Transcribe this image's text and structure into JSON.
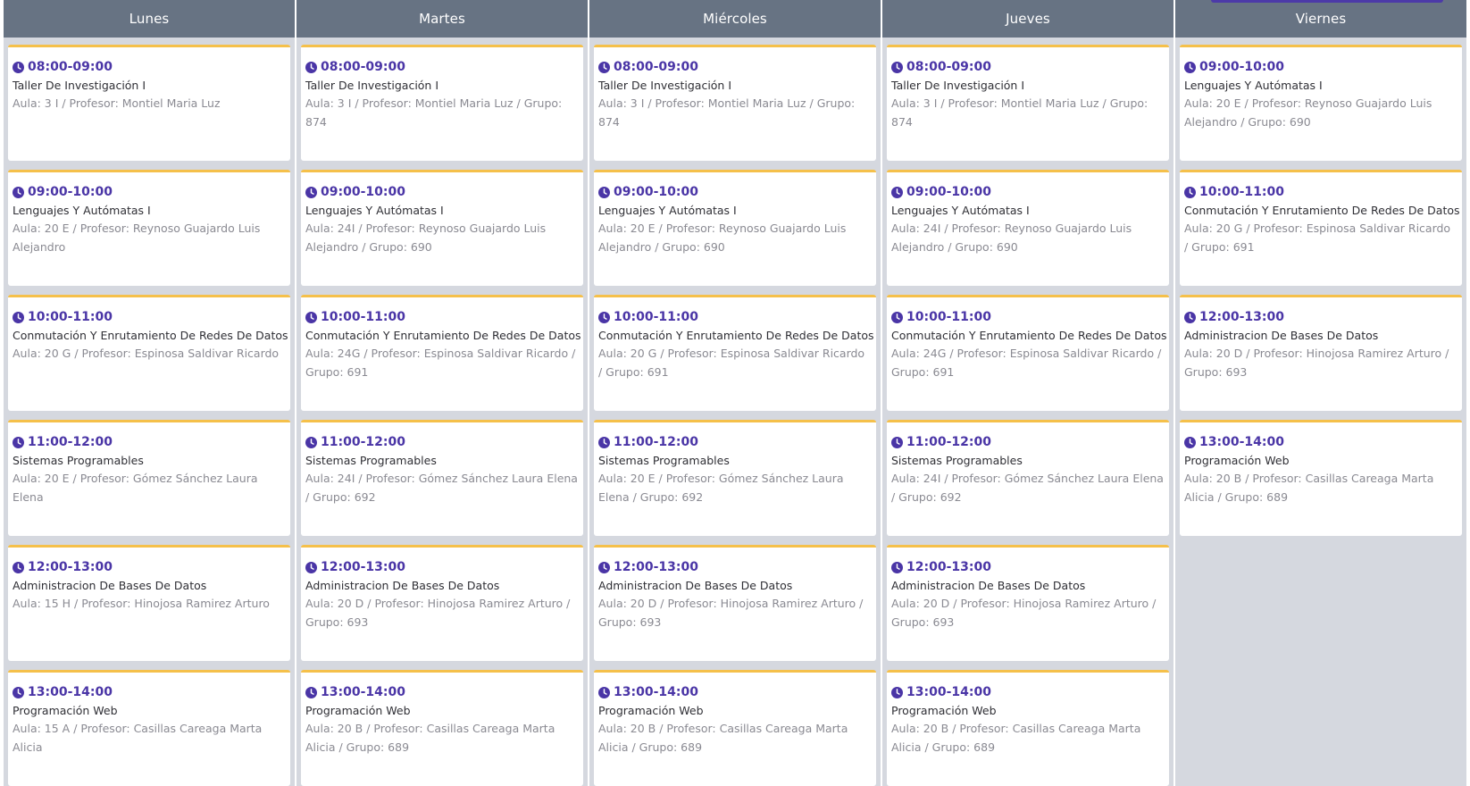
{
  "colors": {
    "header_bg": "#677383",
    "column_bg": "#d5d8df",
    "card_accent": "#f5c04a",
    "time_text": "#4a35a6",
    "detail_text": "#8a8a92"
  },
  "icons": {
    "time": "clock-icon"
  },
  "days": [
    {
      "name": "Lunes",
      "classes": [
        {
          "time": "08:00-09:00",
          "subject": "Taller De Investigación I",
          "details": "Aula: 3 I / Profesor: Montiel Maria Luz"
        },
        {
          "time": "09:00-10:00",
          "subject": "Lenguajes Y Autómatas I",
          "details": "Aula: 20 E / Profesor: Reynoso Guajardo Luis Alejandro"
        },
        {
          "time": "10:00-11:00",
          "subject": "Conmutación Y Enrutamiento De Redes De Datos",
          "details": "Aula: 20 G / Profesor: Espinosa Saldivar Ricardo"
        },
        {
          "time": "11:00-12:00",
          "subject": "Sistemas Programables",
          "details": "Aula: 20 E / Profesor: Gómez Sánchez Laura Elena"
        },
        {
          "time": "12:00-13:00",
          "subject": "Administracion De Bases De Datos",
          "details": "Aula: 15 H / Profesor: Hinojosa Ramirez Arturo"
        },
        {
          "time": "13:00-14:00",
          "subject": "Programación Web",
          "details": "Aula: 15 A / Profesor: Casillas Careaga Marta Alicia"
        }
      ]
    },
    {
      "name": "Martes",
      "classes": [
        {
          "time": "08:00-09:00",
          "subject": "Taller De Investigación I",
          "details": "Aula: 3 I / Profesor: Montiel Maria Luz / Grupo: 874"
        },
        {
          "time": "09:00-10:00",
          "subject": "Lenguajes Y Autómatas I",
          "details": "Aula: 24I / Profesor: Reynoso Guajardo Luis Alejandro / Grupo: 690"
        },
        {
          "time": "10:00-11:00",
          "subject": "Conmutación Y Enrutamiento De Redes De Datos",
          "details": "Aula: 24G / Profesor: Espinosa Saldivar Ricardo / Grupo: 691"
        },
        {
          "time": "11:00-12:00",
          "subject": "Sistemas Programables",
          "details": "Aula: 24I / Profesor: Gómez Sánchez Laura Elena / Grupo: 692"
        },
        {
          "time": "12:00-13:00",
          "subject": "Administracion De Bases De Datos",
          "details": "Aula: 20 D / Profesor: Hinojosa Ramirez Arturo / Grupo: 693"
        },
        {
          "time": "13:00-14:00",
          "subject": "Programación Web",
          "details": "Aula: 20 B / Profesor: Casillas Careaga Marta Alicia / Grupo: 689"
        }
      ]
    },
    {
      "name": "Miércoles",
      "classes": [
        {
          "time": "08:00-09:00",
          "subject": "Taller De Investigación I",
          "details": "Aula: 3 I / Profesor: Montiel Maria Luz / Grupo: 874"
        },
        {
          "time": "09:00-10:00",
          "subject": "Lenguajes Y Autómatas I",
          "details": "Aula: 20 E / Profesor: Reynoso Guajardo Luis Alejandro / Grupo: 690"
        },
        {
          "time": "10:00-11:00",
          "subject": "Conmutación Y Enrutamiento De Redes De Datos",
          "details": "Aula: 20 G / Profesor: Espinosa Saldivar Ricardo / Grupo: 691"
        },
        {
          "time": "11:00-12:00",
          "subject": "Sistemas Programables",
          "details": "Aula: 20 E / Profesor: Gómez Sánchez Laura Elena / Grupo: 692"
        },
        {
          "time": "12:00-13:00",
          "subject": "Administracion De Bases De Datos",
          "details": "Aula: 20 D / Profesor: Hinojosa Ramirez Arturo / Grupo: 693"
        },
        {
          "time": "13:00-14:00",
          "subject": "Programación Web",
          "details": "Aula: 20 B / Profesor: Casillas Careaga Marta Alicia / Grupo: 689"
        }
      ]
    },
    {
      "name": "Jueves",
      "classes": [
        {
          "time": "08:00-09:00",
          "subject": "Taller De Investigación I",
          "details": "Aula: 3 I / Profesor: Montiel Maria Luz / Grupo: 874"
        },
        {
          "time": "09:00-10:00",
          "subject": "Lenguajes Y Autómatas I",
          "details": "Aula: 24I / Profesor: Reynoso Guajardo Luis Alejandro / Grupo: 690"
        },
        {
          "time": "10:00-11:00",
          "subject": "Conmutación Y Enrutamiento De Redes De Datos",
          "details": "Aula: 24G / Profesor: Espinosa Saldivar Ricardo / Grupo: 691"
        },
        {
          "time": "11:00-12:00",
          "subject": "Sistemas Programables",
          "details": "Aula: 24I / Profesor: Gómez Sánchez Laura Elena / Grupo: 692"
        },
        {
          "time": "12:00-13:00",
          "subject": "Administracion De Bases De Datos",
          "details": "Aula: 20 D / Profesor: Hinojosa Ramirez Arturo / Grupo: 693"
        },
        {
          "time": "13:00-14:00",
          "subject": "Programación Web",
          "details": "Aula: 20 B / Profesor: Casillas Careaga Marta Alicia / Grupo: 689"
        }
      ]
    },
    {
      "name": "Viernes",
      "classes": [
        {
          "time": "09:00-10:00",
          "subject": "Lenguajes Y Autómatas I",
          "details": "Aula: 20 E / Profesor: Reynoso Guajardo Luis Alejandro / Grupo: 690"
        },
        {
          "time": "10:00-11:00",
          "subject": "Conmutación Y Enrutamiento De Redes De Datos",
          "details": "Aula: 20 G / Profesor: Espinosa Saldivar Ricardo / Grupo: 691"
        },
        {
          "time": "12:00-13:00",
          "subject": "Administracion De Bases De Datos",
          "details": "Aula: 20 D / Profesor: Hinojosa Ramirez Arturo / Grupo: 693"
        },
        {
          "time": "13:00-14:00",
          "subject": "Programación Web",
          "details": "Aula: 20 B / Profesor: Casillas Careaga Marta Alicia / Grupo: 689"
        }
      ]
    }
  ]
}
